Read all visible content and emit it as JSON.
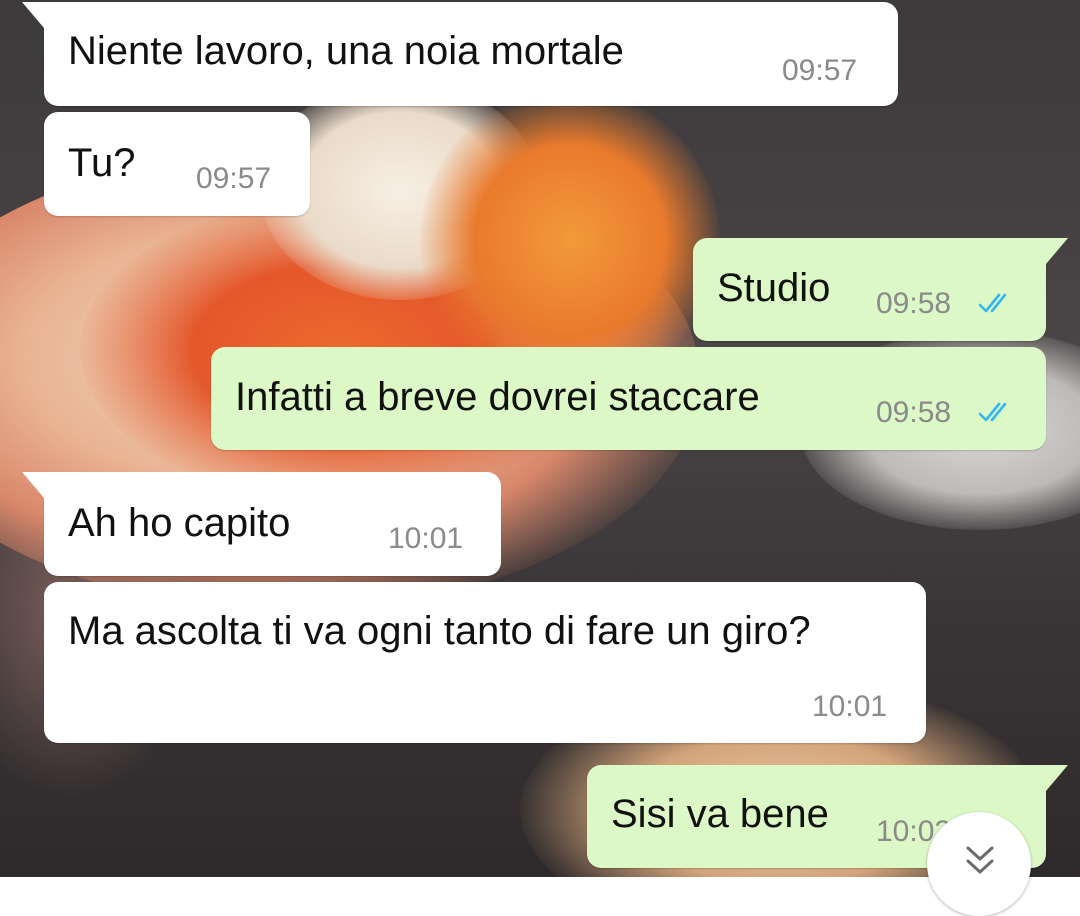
{
  "messages": [
    {
      "direction": "incoming",
      "text": "Niente lavoro, una noia mortale",
      "time": "09:57"
    },
    {
      "direction": "incoming",
      "text": "Tu?",
      "time": "09:57"
    },
    {
      "direction": "outgoing",
      "text": "Studio",
      "time": "09:58",
      "status": "read"
    },
    {
      "direction": "outgoing",
      "text": "Infatti a breve dovrei staccare",
      "time": "09:58",
      "status": "read"
    },
    {
      "direction": "incoming",
      "text": "Ah ho capito",
      "time": "10:01"
    },
    {
      "direction": "incoming",
      "text": "Ma ascolta ti va ogni tanto di fare un giro?",
      "time": "10:01"
    },
    {
      "direction": "outgoing",
      "text": "Sisi va bene",
      "time": "10:02",
      "status": "read"
    }
  ],
  "icons": {
    "read_receipt": "double-check-icon",
    "scroll_down": "chevron-double-down-icon"
  },
  "colors": {
    "incoming_bubble": "#ffffff",
    "outgoing_bubble": "#dcf8c6",
    "read_ticks": "#34b7f1",
    "timestamp": "#8a8a8a"
  }
}
